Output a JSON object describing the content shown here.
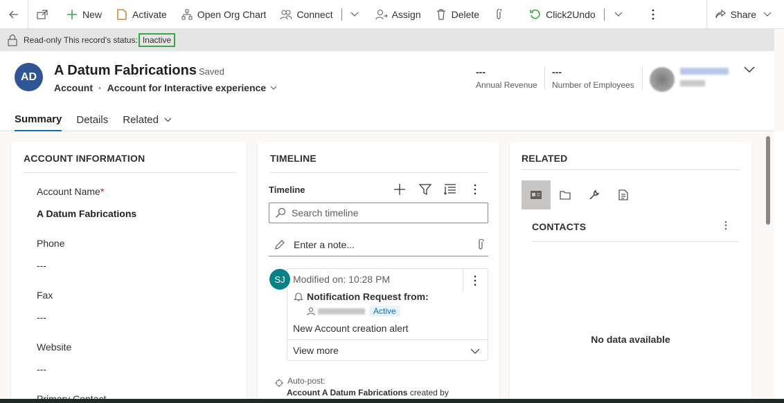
{
  "command_bar": {
    "new_label": "New",
    "activate_label": "Activate",
    "org_chart_label": "Open Org Chart",
    "connect_label": "Connect",
    "assign_label": "Assign",
    "delete_label": "Delete",
    "click2undo_label": "Click2Undo",
    "share_label": "Share"
  },
  "banner": {
    "prefix": "Read-only  This record's status:",
    "status": "Inactive"
  },
  "record": {
    "initials": "AD",
    "title": "A Datum Fabrications",
    "saved": "- Saved",
    "entity": "Account",
    "separator": "·",
    "form": "Account for Interactive experience"
  },
  "header_fields": [
    {
      "value": "---",
      "label": "Annual Revenue"
    },
    {
      "value": "---",
      "label": "Number of Employees"
    }
  ],
  "tabs": [
    "Summary",
    "Details",
    "Related"
  ],
  "account_info": {
    "title": "ACCOUNT INFORMATION",
    "fields": [
      {
        "label": "Account Name",
        "value": "A Datum Fabrications",
        "required": "*"
      },
      {
        "label": "Phone",
        "value": "---"
      },
      {
        "label": "Fax",
        "value": "---"
      },
      {
        "label": "Website",
        "value": "---"
      },
      {
        "label": "Primary Contact",
        "value": ""
      }
    ]
  },
  "timeline": {
    "section_title": "TIMELINE",
    "header": "Timeline",
    "search_placeholder": "Search timeline",
    "note_placeholder": "Enter a note...",
    "card": {
      "avatar": "SJ",
      "modified": "Modified on: 10:28 PM",
      "title": "Notification Request from:",
      "status": "Active",
      "body": "New Account creation alert",
      "view_more": "View more"
    },
    "autopost": {
      "label": "Auto-post:",
      "text_bold": "Account A Datum Fabrications",
      "text_rest": "created by"
    }
  },
  "related": {
    "title": "RELATED",
    "contacts_title": "CONTACTS",
    "empty": "No data available"
  },
  "colors": {
    "accent": "#0f6cbd",
    "avatar": "#2f5596",
    "timeline_avatar": "#038387",
    "status_highlight": "#3ca34b",
    "undo_green": "#3ca34b"
  }
}
